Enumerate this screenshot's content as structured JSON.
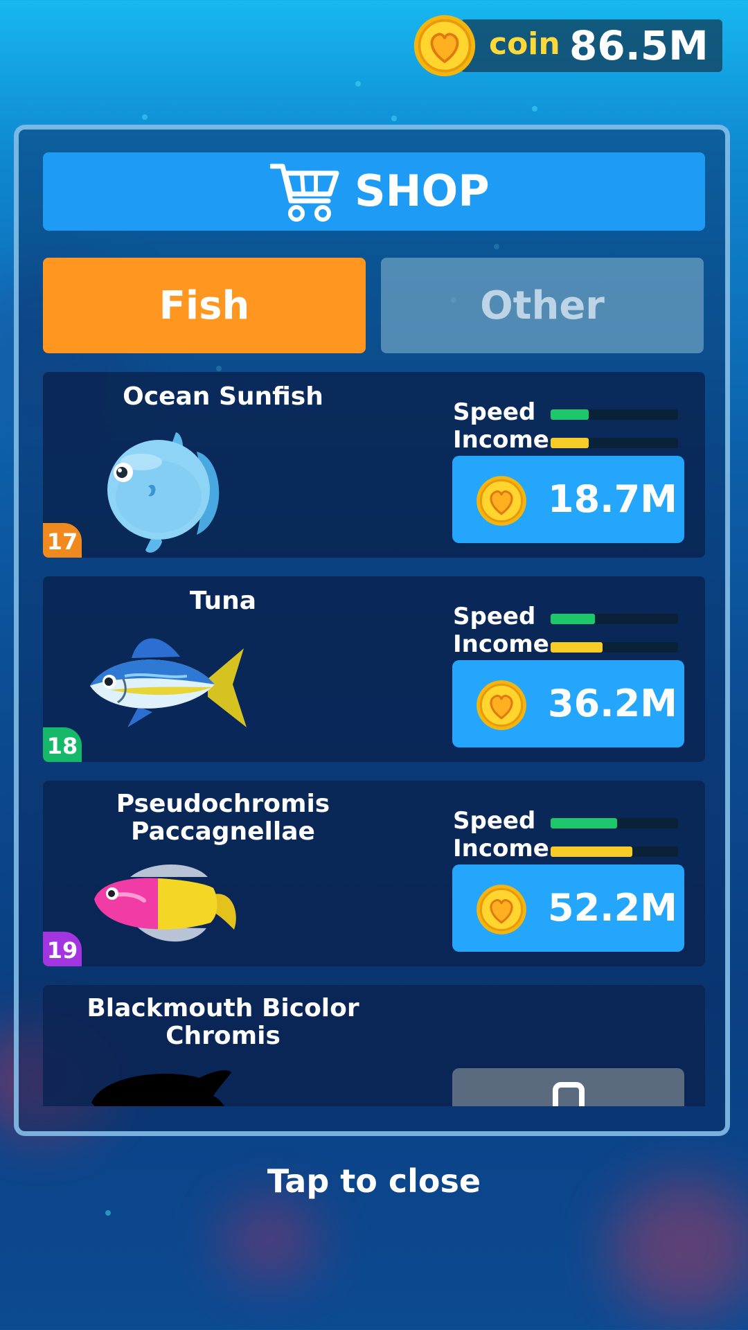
{
  "header": {
    "coin_label": "coin",
    "coin_amount": "86.5M"
  },
  "shop": {
    "title": "SHOP",
    "tabs": [
      {
        "label": "Fish",
        "active": true
      },
      {
        "label": "Other",
        "active": false
      }
    ]
  },
  "fish": [
    {
      "name": "Ocean Sunfish",
      "level": "17",
      "badge_color": "#f08a1e",
      "speed_label": "Speed",
      "income_label": "Income",
      "speed": 0.3,
      "income": 0.3,
      "price": "18.7M"
    },
    {
      "name": "Tuna",
      "level": "18",
      "badge_color": "#16b86a",
      "speed_label": "Speed",
      "income_label": "Income",
      "speed": 0.35,
      "income": 0.41,
      "price": "36.2M"
    },
    {
      "name": "Pseudochromis\nPaccagnellae",
      "level": "19",
      "badge_color": "#a235e0",
      "speed_label": "Speed",
      "income_label": "Income",
      "speed": 0.52,
      "income": 0.64,
      "price": "52.2M"
    },
    {
      "name": "Blackmouth Bicolor\nChromis",
      "locked": true
    }
  ],
  "footer": {
    "close_text": "Tap to close"
  },
  "colors": {
    "speed_bar": "#1ec86a",
    "income_bar": "#f8cc26",
    "price_button": "#23a6fb",
    "tab_active": "#ff961f"
  }
}
